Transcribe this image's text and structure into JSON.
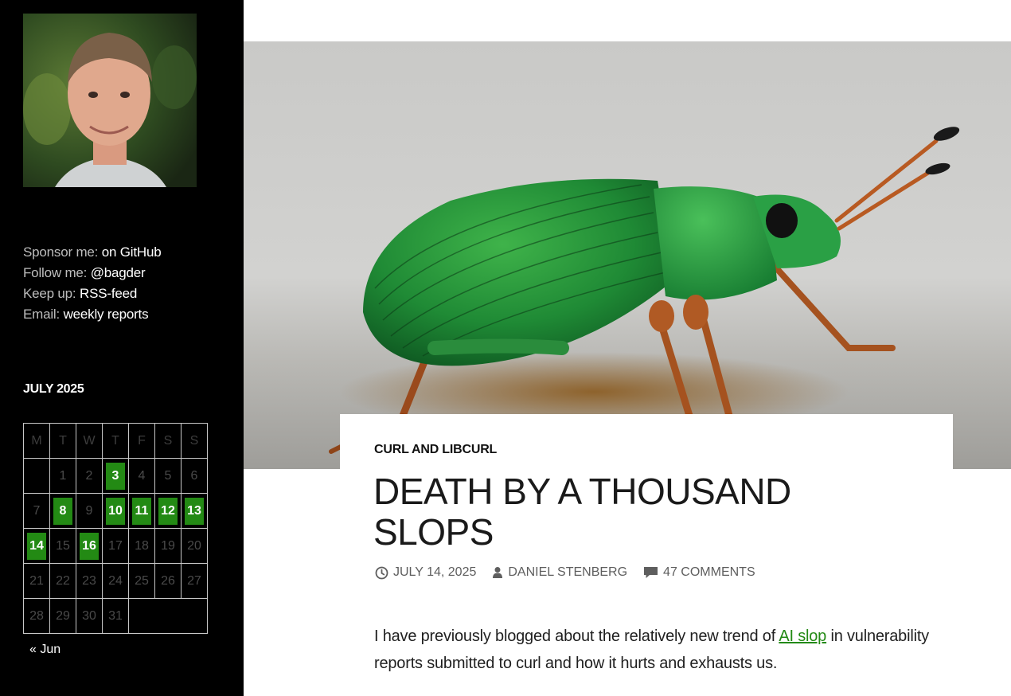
{
  "sidebar": {
    "links": [
      {
        "label": "Sponsor me:",
        "value": "on GitHub"
      },
      {
        "label": "Follow me:",
        "value": "@bagder"
      },
      {
        "label": "Keep up:",
        "value": "RSS-feed"
      },
      {
        "label": "Email:",
        "value": "weekly reports"
      }
    ],
    "calendar": {
      "title": "JULY 2025",
      "weekdays": [
        "M",
        "T",
        "W",
        "T",
        "F",
        "S",
        "S"
      ],
      "prev_link": "« Jun"
    }
  },
  "article": {
    "category": "CURL AND LIBCURL",
    "title": "DEATH BY A THOUSAND SLOPS",
    "date": "JULY 14, 2025",
    "author": "DANIEL STENBERG",
    "comments": "47 COMMENTS",
    "body_before": "I have previously blogged about the relatively new trend of ",
    "body_link": "AI slop",
    "body_after": " in vulnerability reports submitted to curl and how it hurts and ex­hausts us."
  },
  "colors": {
    "link_green": "#238a14",
    "sidebar_bg": "#000000"
  }
}
